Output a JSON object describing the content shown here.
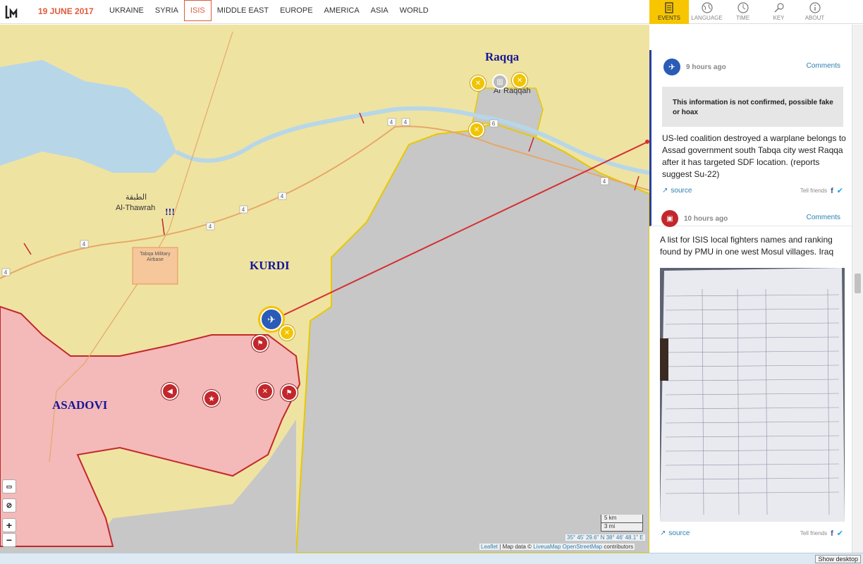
{
  "header": {
    "date": "19 JUNE 2017",
    "nav": [
      "UKRAINE",
      "SYRIA",
      "ISIS",
      "MIDDLE EAST",
      "EUROPE",
      "AMERICA",
      "ASIA",
      "WORLD"
    ],
    "active_nav": "ISIS",
    "tools": [
      {
        "label": "EVENTS",
        "icon": "events-icon"
      },
      {
        "label": "LANGUAGE",
        "icon": "globe-icon"
      },
      {
        "label": "TIME",
        "icon": "clock-icon"
      },
      {
        "label": "KEY",
        "icon": "key-icon"
      },
      {
        "label": "ABOUT",
        "icon": "info-icon"
      }
    ]
  },
  "map": {
    "labels": {
      "raqqa": "Raqqa",
      "ar_raqqah": "Ar Raqqah",
      "thawrah_ar": "الطبقة",
      "thawrah": "Al-Thawrah",
      "airbase": "Tabqa Military Airbase",
      "kurdi": "KURDI",
      "asadovi": "ASADOVI",
      "exclaim": "!!!"
    },
    "road_numbers": [
      "4",
      "4",
      "4",
      "4",
      "4",
      "4",
      "4",
      "6",
      "4"
    ],
    "scale": {
      "km": "5 km",
      "mi": "3 mi"
    },
    "coords": "35° 45' 29.6\" N 38° 46' 48.1\" E",
    "attribution": {
      "leaflet": "Leaflet",
      "data": "| Map data ©",
      "liveua": "LiveuaMap",
      "osm": "OpenStreetMap",
      "contrib": "contributors"
    },
    "controls": {
      "zoom_in": "+",
      "zoom_out": "−"
    },
    "colors": {
      "kurdish": "#efe3a2",
      "government": "#f4b9b9",
      "isis": "#c7c7c7",
      "river": "#b7d7e8"
    }
  },
  "events": [
    {
      "time": "9 hours ago",
      "comments": "Comments",
      "warning": "This information is not confirmed, possible fake or hoax",
      "text": "US-led coalition destroyed a warplane belongs to Assad government south Tabqa city west Raqqa after it has targeted SDF location. (reports suggest Su-22)",
      "source": "source",
      "tell": "Tell friends",
      "icon": "plane-icon",
      "color": "#2a5bb6"
    },
    {
      "time": "10 hours ago",
      "comments": "Comments",
      "text": "A list for ISIS local fighters names and ranking found by PMU in one west Mosul villages. Iraq",
      "source": "source",
      "tell": "Tell friends",
      "icon": "photo-icon",
      "color": "#c3272b"
    }
  ],
  "footer": {
    "show_desktop": "Show desktop"
  }
}
